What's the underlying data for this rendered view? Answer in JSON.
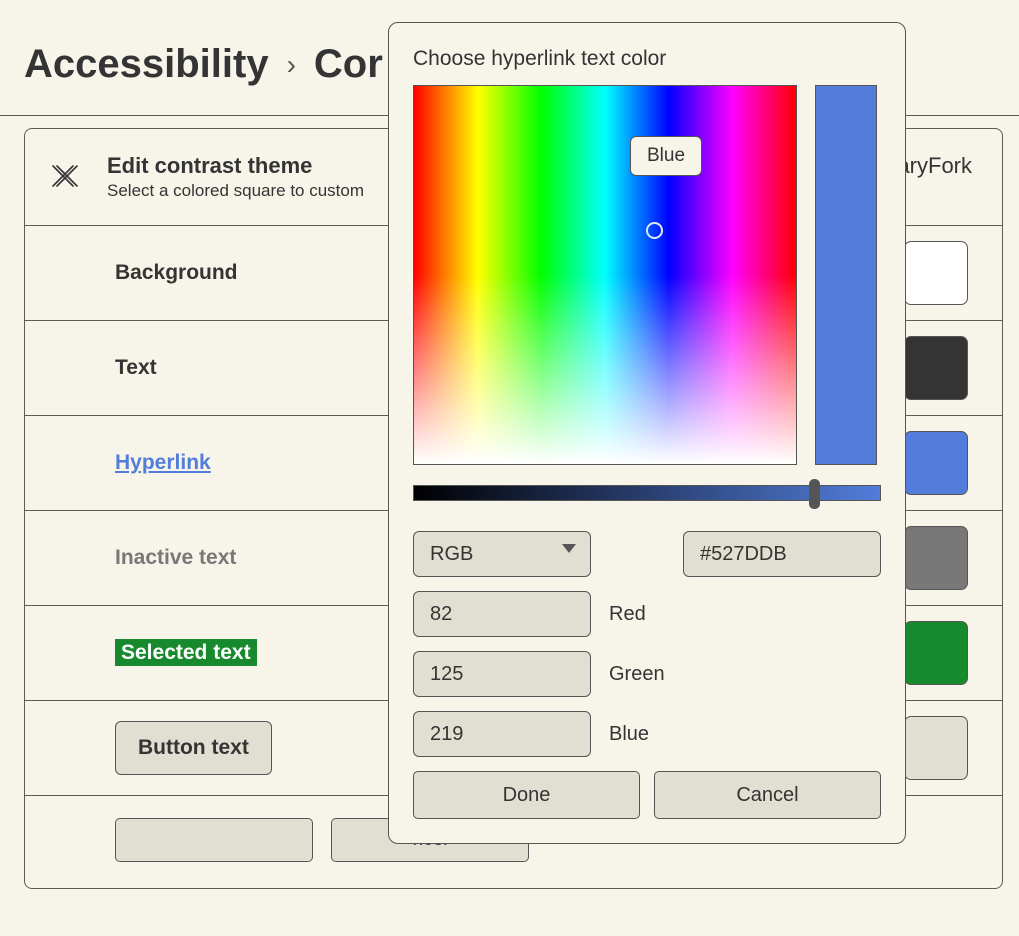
{
  "breadcrumb": {
    "root": "Accessibility",
    "current_truncated": "Cor"
  },
  "header": {
    "title": "Edit contrast theme",
    "subtitle": "Select a colored square to custom",
    "theme_name_fragment": "naryFork"
  },
  "rows": {
    "background": {
      "label": "Background",
      "color": "#ffffff"
    },
    "text": {
      "label": "Text",
      "color": "#343434"
    },
    "hyperlink": {
      "label": "Hyperlink",
      "color": "#527ddb"
    },
    "inactive": {
      "label": "Inactive text",
      "color": "#787878"
    },
    "selected": {
      "label": "Selected text",
      "color": "#178a2d"
    },
    "button": {
      "label": "Button text",
      "color": "#e1dfd1"
    }
  },
  "actions": {
    "save_truncated": "",
    "cancel_truncated": "ncel"
  },
  "picker": {
    "title": "Choose hyperlink text color",
    "tooltip": "Blue",
    "mode": "RGB",
    "hex": "#527DDB",
    "channels": {
      "r": 82,
      "g": 125,
      "b": 219
    },
    "labels": {
      "r": "Red",
      "g": "Green",
      "b": "Blue"
    },
    "done": "Done",
    "cancel": "Cancel"
  }
}
